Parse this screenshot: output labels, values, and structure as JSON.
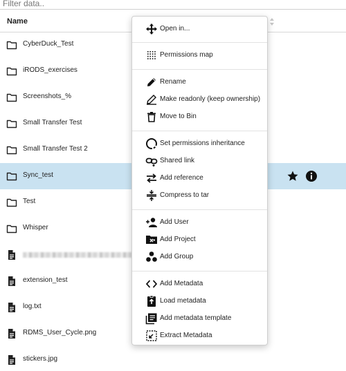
{
  "filter": {
    "placeholder": "Filter data.."
  },
  "table": {
    "name_header": "Name"
  },
  "rows": [
    {
      "name": "CyberDuck_Test",
      "type": "folder-icon"
    },
    {
      "name": "iRODS_exercises",
      "type": "folder-icon"
    },
    {
      "name": "Screenshots_%",
      "type": "folder-icon"
    },
    {
      "name": "Small Transfer Test",
      "type": "folder-icon"
    },
    {
      "name": "Small Transfer Test 2",
      "type": "folder-icon"
    },
    {
      "name": "Sync_test",
      "type": "folder-icon",
      "selected": true
    },
    {
      "name": "Test",
      "type": "folder-icon"
    },
    {
      "name": "Whisper",
      "type": "folder-icon"
    },
    {
      "name": "",
      "type": "file-icon",
      "redacted": true
    },
    {
      "name": "extension_test",
      "type": "file-icon"
    },
    {
      "name": "log.txt",
      "type": "file-icon"
    },
    {
      "name": "RDMS_User_Cycle.png",
      "type": "file-icon"
    },
    {
      "name": "stickers.jpg",
      "type": "file-icon"
    }
  ],
  "row_actions": {
    "favorite_icon": "star-icon",
    "info_icon": "info-icon"
  },
  "context_menu": {
    "items": [
      {
        "label": "Open in...",
        "icon": "move-arrows-icon"
      },
      {
        "label": "Permissions map",
        "icon": "dot-grid-icon"
      },
      {
        "label": "Rename",
        "icon": "pencil-icon"
      },
      {
        "label": "Make readonly (keep ownership)",
        "icon": "pencil-off-icon"
      },
      {
        "label": "Move to Bin",
        "icon": "trash-icon"
      },
      {
        "label": "Set permissions inheritance",
        "icon": "circle-arrows-icon"
      },
      {
        "label": "Shared link",
        "icon": "link-icon"
      },
      {
        "label": "Add reference",
        "icon": "swap-arrows-icon"
      },
      {
        "label": "Compress to tar",
        "icon": "compress-icon"
      },
      {
        "label": "Add User",
        "icon": "add-user-icon"
      },
      {
        "label": "Add Project",
        "icon": "folder-project-icon"
      },
      {
        "label": "Add Group",
        "icon": "group-icon"
      },
      {
        "label": "Add Metadata",
        "icon": "code-icon"
      },
      {
        "label": "Load metadata",
        "icon": "upload-icon"
      },
      {
        "label": "Add metadata template",
        "icon": "template-icon"
      },
      {
        "label": "Extract Metadata",
        "icon": "extract-icon"
      }
    ]
  },
  "colors": {
    "selected_row": "#c9e2f1",
    "text": "#222222"
  }
}
